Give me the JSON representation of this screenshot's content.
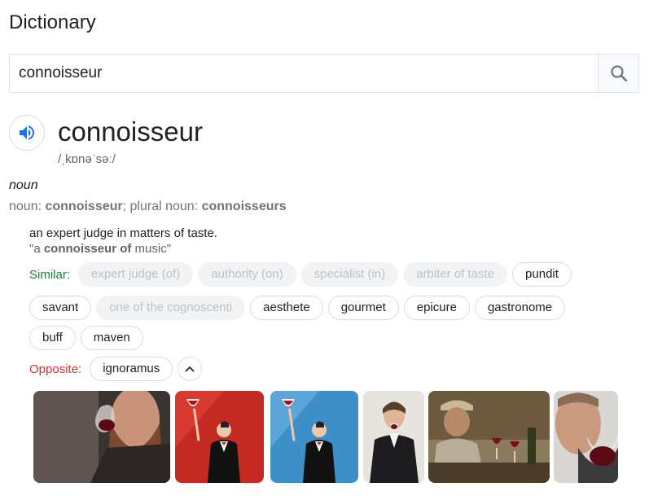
{
  "header": {
    "title": "Dictionary"
  },
  "search": {
    "value": "connoisseur",
    "button_icon": "search-icon"
  },
  "entry": {
    "word": "connoisseur",
    "phonetic": "/ˌkɒnəˈsəː/",
    "part_of_speech": "noun",
    "forms": {
      "noun_label": "noun: ",
      "noun_value": "connoisseur",
      "plural_label": "; plural noun: ",
      "plural_value": "connoisseurs"
    },
    "definition": "an expert judge in matters of taste.",
    "example": {
      "open_quote": "\"a ",
      "bold": "connoisseur of",
      "rest": " music\""
    }
  },
  "similar": {
    "label": "Similar:",
    "rows": [
      [
        {
          "text": "expert judge (of)",
          "active": false
        },
        {
          "text": "authority (on)",
          "active": false
        },
        {
          "text": "specialist (in)",
          "active": false
        },
        {
          "text": "arbiter of taste",
          "active": false
        },
        {
          "text": "pundit",
          "active": true
        }
      ],
      [
        {
          "text": "savant",
          "active": true
        },
        {
          "text": "one of the cognoscenti",
          "active": false
        },
        {
          "text": "aesthete",
          "active": true
        },
        {
          "text": "gourmet",
          "active": true
        },
        {
          "text": "epicure",
          "active": true
        },
        {
          "text": "gastronome",
          "active": true
        }
      ],
      [
        {
          "text": "buff",
          "active": true
        },
        {
          "text": "maven",
          "active": true
        }
      ]
    ]
  },
  "opposite": {
    "label": "Opposite:",
    "items": [
      {
        "text": "ignoramus",
        "active": true
      }
    ]
  },
  "images": [
    {
      "name": "image-man-swirling-wine"
    },
    {
      "name": "image-cartoon-waiter-red"
    },
    {
      "name": "image-cartoon-waiter-blue"
    },
    {
      "name": "image-man-with-glass"
    },
    {
      "name": "image-old-man-wine-table"
    },
    {
      "name": "image-man-sniffing-wine"
    }
  ],
  "colors": {
    "similar_label": "#188038",
    "opposite_label": "#d93025",
    "speaker_icon": "#1a73e8"
  }
}
